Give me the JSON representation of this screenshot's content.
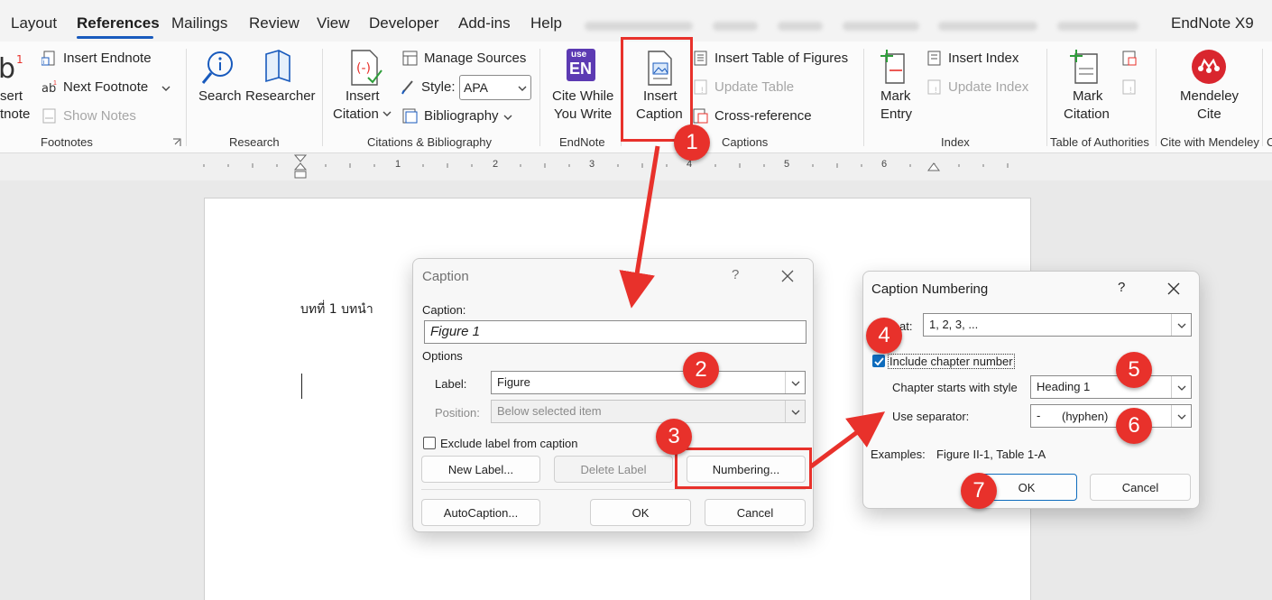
{
  "menu": {
    "tabs": [
      "Layout",
      "References",
      "Mailings",
      "Review",
      "View",
      "Developer",
      "Add-ins",
      "Help"
    ],
    "active": "References",
    "endnote_tab": "EndNote X9"
  },
  "ribbon": {
    "footnotes": {
      "insert_label_1": "sert",
      "insert_label_2": "tnote",
      "insert_endnote": "Insert Endnote",
      "next_footnote": "Next Footnote",
      "show_notes": "Show Notes",
      "group": "Footnotes"
    },
    "research": {
      "search": "Search",
      "researcher": "Researcher",
      "group": "Research"
    },
    "citations": {
      "insert_citation_1": "Insert",
      "insert_citation_2": "Citation",
      "manage_sources": "Manage Sources",
      "style_label": "Style:",
      "style_value": "APA",
      "bibliography": "Bibliography",
      "group": "Citations & Bibliography"
    },
    "endnote": {
      "cite_1": "Cite While",
      "cite_2": "You Write",
      "group": "EndNote",
      "logo_top": "use",
      "logo_bottom": "EN"
    },
    "captions": {
      "insert_caption_1": "Insert",
      "insert_caption_2": "Caption",
      "insert_table_of_figures": "Insert Table of Figures",
      "update_table": "Update Table",
      "cross_reference": "Cross-reference",
      "group": "Captions"
    },
    "index": {
      "mark_entry_1": "Mark",
      "mark_entry_2": "Entry",
      "insert_index": "Insert Index",
      "update_index": "Update Index",
      "group": "Index"
    },
    "authorities": {
      "mark_citation_1": "Mark",
      "mark_citation_2": "Citation",
      "group": "Table of Authorities"
    },
    "mendeley": {
      "cite_1": "Mendeley",
      "cite_2": "Cite",
      "group": "Cite with Mendeley",
      "partial": "C"
    }
  },
  "ruler": {
    "numbers": [
      "1",
      "2",
      "3",
      "4",
      "5",
      "6"
    ]
  },
  "document": {
    "text": "บทที่ 1 บทนำ"
  },
  "caption_dialog": {
    "title": "Caption",
    "help": "?",
    "caption_label": "Caption:",
    "caption_value": "Figure 1",
    "options_label": "Options",
    "label_label": "Label:",
    "label_value": "Figure",
    "position_label": "Position:",
    "position_value": "Below selected item",
    "exclude_label": "Exclude label from caption",
    "new_label_button": "New Label...",
    "delete_label_button": "Delete Label",
    "numbering_button": "Numbering...",
    "autocaption_button": "AutoCaption...",
    "ok_button": "OK",
    "cancel_button": "Cancel"
  },
  "numbering_dialog": {
    "title": "Caption Numbering",
    "help": "?",
    "format_label": "at:",
    "format_value": "1, 2, 3, ...",
    "include_chapter_label": "Include chapter number",
    "include_chapter_checked": true,
    "chapter_style_label": "Chapter starts with style",
    "chapter_style_value": "Heading 1",
    "separator_label": "Use separator:",
    "separator_value": "-",
    "separator_name": "(hyphen)",
    "examples_label": "Examples:",
    "examples_value": "Figure II-1, Table 1-A",
    "ok_button": "OK",
    "cancel_button": "Cancel"
  },
  "steps": [
    "1",
    "2",
    "3",
    "4",
    "5",
    "6",
    "7"
  ],
  "colors": {
    "annotation_red": "#e8312b",
    "accent_blue": "#0f6cbd",
    "menu_underline": "#185abd"
  }
}
